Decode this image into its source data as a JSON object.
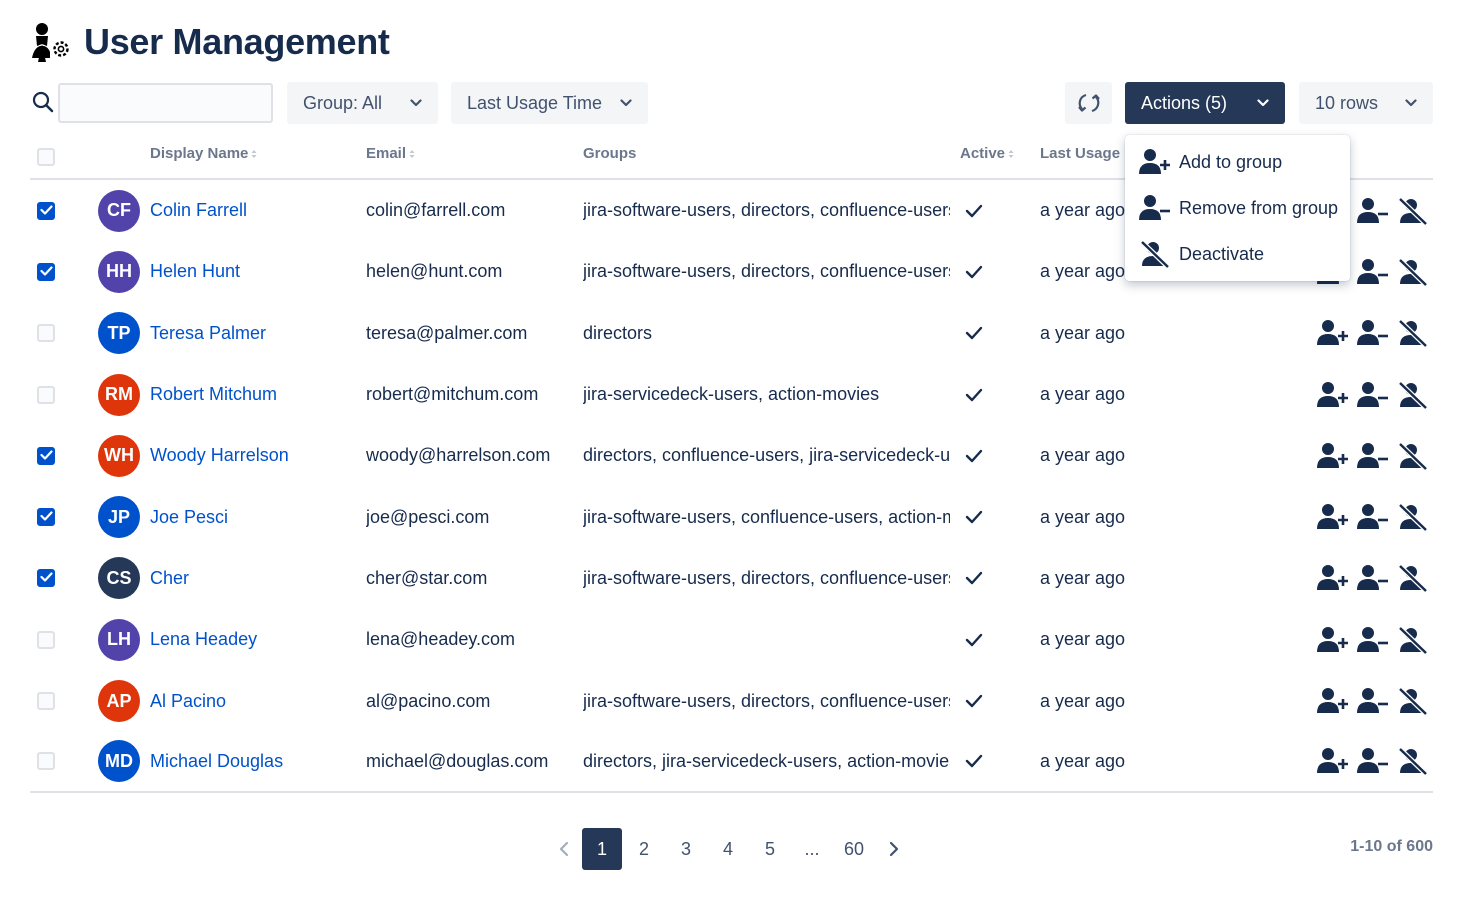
{
  "header": {
    "title": "User Management",
    "logo_icon": "user-settings-icon"
  },
  "toolbar": {
    "search": {
      "value": "",
      "placeholder": ""
    },
    "group_filter": "Group: All",
    "usage_filter": "Last Usage Time",
    "actions_label": "Actions (5)",
    "rows_label": "10 rows"
  },
  "columns": {
    "display_name": "Display Name",
    "email": "Email",
    "groups": "Groups",
    "active": "Active",
    "last_usage": "Last Usage"
  },
  "actions_menu": [
    {
      "label": "Add to group",
      "icon": "user-add-icon"
    },
    {
      "label": "Remove from group",
      "icon": "user-remove-icon"
    },
    {
      "label": "Deactivate",
      "icon": "user-deactivate-icon"
    }
  ],
  "users": [
    {
      "initials": "CF",
      "name": "Colin Farrell",
      "email": "colin@farrell.com",
      "groups": "jira-software-users, directors, confluence-users",
      "usage": "a year ago",
      "selected": true,
      "color": "#5243aa"
    },
    {
      "initials": "HH",
      "name": "Helen Hunt",
      "email": "helen@hunt.com",
      "groups": "jira-software-users, directors, confluence-users",
      "usage": "a year ago",
      "selected": true,
      "color": "#5243aa"
    },
    {
      "initials": "TP",
      "name": "Teresa Palmer",
      "email": "teresa@palmer.com",
      "groups": "directors",
      "usage": "a year ago",
      "selected": false,
      "color": "#0052cc"
    },
    {
      "initials": "RM",
      "name": "Robert Mitchum",
      "email": "robert@mitchum.com",
      "groups": "jira-servicedeck-users, action-movies",
      "usage": "a year ago",
      "selected": false,
      "color": "#de350b"
    },
    {
      "initials": "WH",
      "name": "Woody Harrelson",
      "email": "woody@harrelson.com",
      "groups": "directors, confluence-users, jira-servicedeck-users",
      "usage": "a year ago",
      "selected": true,
      "color": "#de350b"
    },
    {
      "initials": "JP",
      "name": "Joe Pesci",
      "email": "joe@pesci.com",
      "groups": "jira-software-users, confluence-users, action-movies",
      "usage": "a year ago",
      "selected": true,
      "color": "#0052cc"
    },
    {
      "initials": "CS",
      "name": "Cher",
      "email": "cher@star.com",
      "groups": "jira-software-users, directors, confluence-users",
      "usage": "a year ago",
      "selected": true,
      "color": "#253858"
    },
    {
      "initials": "LH",
      "name": "Lena Headey",
      "email": "lena@headey.com",
      "groups": "",
      "usage": "a year ago",
      "selected": false,
      "color": "#5243aa"
    },
    {
      "initials": "AP",
      "name": "Al Pacino",
      "email": "al@pacino.com",
      "groups": "jira-software-users, directors, confluence-users",
      "usage": "a year ago",
      "selected": false,
      "color": "#de350b"
    },
    {
      "initials": "MD",
      "name": "Michael Douglas",
      "email": "michael@douglas.com",
      "groups": "directors, jira-servicedeck-users, action-movies",
      "usage": "a year ago",
      "selected": false,
      "color": "#0052cc"
    }
  ],
  "pagination": {
    "pages": [
      "1",
      "2",
      "3",
      "4",
      "5",
      "...",
      "60"
    ],
    "current": "1",
    "summary": "1-10 of 600"
  },
  "colors": {
    "primary": "#253858",
    "link": "#0052cc",
    "checkbox_on": "#0052cc"
  }
}
